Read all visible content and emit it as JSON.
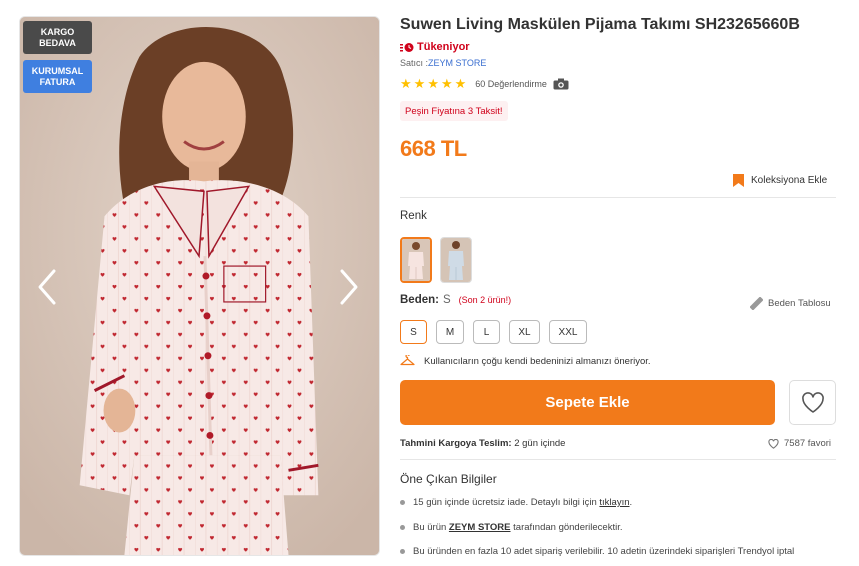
{
  "image": {
    "badges": {
      "kargo": "KARGO\nBEDAVA",
      "kurumsal": "KURUMSAL\nFATURA"
    },
    "prev_icon": "chevron-left-icon",
    "next_icon": "chevron-right-icon"
  },
  "product": {
    "brand": "Suwen",
    "name": "Living Maskülen Pijama Takımı SH23265660B",
    "stock_status": "Tükeniyor",
    "seller_prefix": "Satıcı :",
    "seller_name": "ZEYM STORE",
    "rating": 5,
    "rating_count": "60 Değerlendirme",
    "promo": "Peşin Fiyatına 3 Taksit!",
    "price": "668 TL",
    "collection_label": "Koleksiyona Ekle"
  },
  "variants": {
    "color_label": "Renk",
    "size_label": "Beden:",
    "selected_size": "S",
    "stock_note": "(Son 2 ürün!)",
    "size_chart_label": "Beden Tablosu",
    "sizes": [
      "S",
      "M",
      "L",
      "XL",
      "XXL"
    ],
    "recommendation": "Kullanıcıların çoğu kendi bedeninizi almanızı öneriyor."
  },
  "actions": {
    "add_to_cart": "Sepete Ekle"
  },
  "shipping": {
    "label": "Tahmini Kargoya Teslim:",
    "value": "2 gün içinde",
    "favorites": "7587 favori"
  },
  "features": {
    "title": "Öne Çıkan Bilgiler",
    "item1_text": "15 gün içinde ücretsiz iade. Detaylı bilgi için",
    "item1_link": "tıklayın",
    "item1_end": ".",
    "item2_pre": "Bu ürün",
    "item2_seller": "ZEYM STORE",
    "item2_post": "tarafından gönderilecektir.",
    "item3_text": "Bu üründen en fazla 10 adet sipariş verilebilir. 10 adetin üzerindeki siparişleri Trendyol iptal"
  },
  "colors": {
    "accent": "#f27a1a",
    "alert": "#d0021b",
    "link": "#3b6fd0",
    "badge_dark": "#4a4a4a",
    "badge_blue": "#3f7fe0",
    "star": "#ffc000"
  }
}
